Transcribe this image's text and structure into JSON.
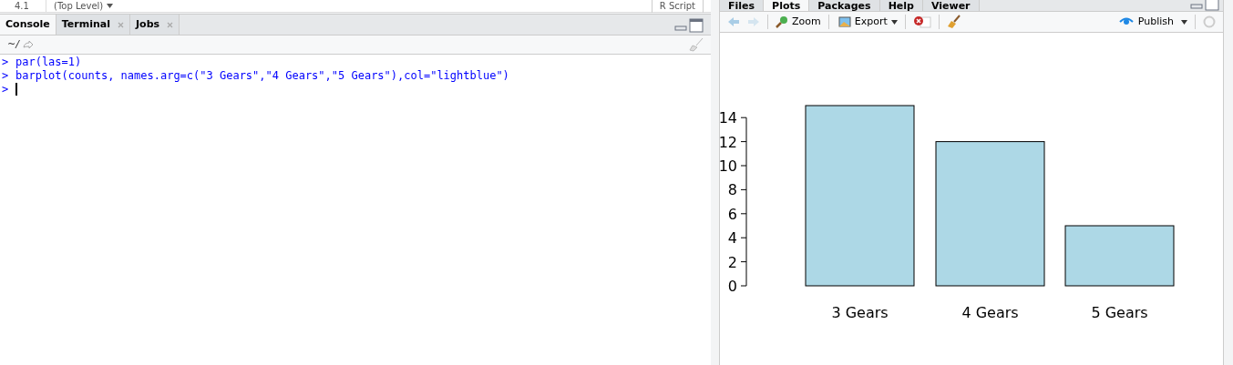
{
  "top_strip": {
    "line": "4.1",
    "scope": "(Top Level)",
    "file_type": "R Script"
  },
  "console_pane": {
    "tabs": [
      {
        "label": "Console",
        "selected": true,
        "closable": false
      },
      {
        "label": "Terminal",
        "selected": false,
        "closable": true
      },
      {
        "label": "Jobs",
        "selected": false,
        "closable": true
      }
    ],
    "path": "~/",
    "lines": [
      {
        "prompt": ">",
        "code": "par(las=1)"
      },
      {
        "prompt": ">",
        "code": "barplot(counts, names.arg=c(\"3 Gears\",\"4 Gears\",\"5 Gears\"),col=\"lightblue\")"
      },
      {
        "prompt": ">"
      }
    ]
  },
  "plots_pane": {
    "tabs": [
      {
        "label": "Files",
        "selected": false
      },
      {
        "label": "Plots",
        "selected": true
      },
      {
        "label": "Packages",
        "selected": false
      },
      {
        "label": "Help",
        "selected": false
      },
      {
        "label": "Viewer",
        "selected": false
      }
    ],
    "toolbar": {
      "zoom": "Zoom",
      "export": "Export",
      "publish": "Publish"
    },
    "chart_data": {
      "type": "bar",
      "categories": [
        "3 Gears",
        "4 Gears",
        "5 Gears"
      ],
      "series": [
        {
          "color": "#add8e6",
          "values": [
            15,
            12,
            5
          ]
        }
      ],
      "ylim": [
        0,
        15
      ],
      "yticks": [
        0,
        2,
        4,
        6,
        8,
        10,
        12,
        14
      ]
    }
  }
}
